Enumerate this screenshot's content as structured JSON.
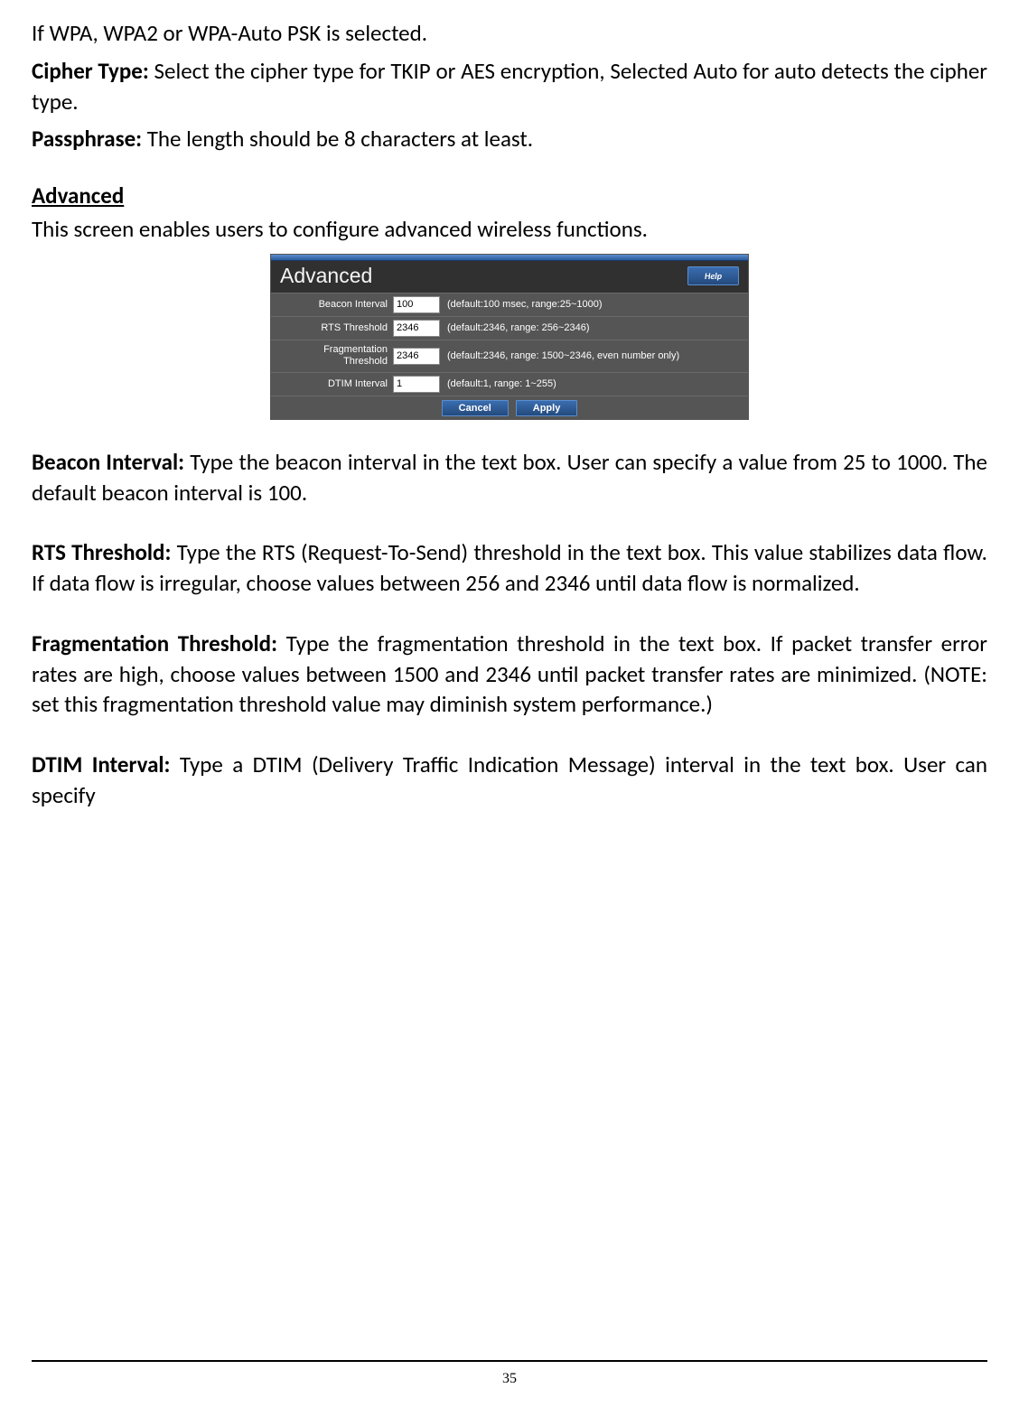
{
  "top": {
    "condition_line": "If WPA, WPA2 or WPA-Auto PSK is selected.",
    "cipher": {
      "label": "Cipher Type:",
      "text": " Select the cipher type for TKIP or AES encryption, Selected Auto for auto detects the cipher type."
    },
    "passphrase": {
      "label": "Passphrase:",
      "text": " The length should be 8 characters at least."
    }
  },
  "advanced": {
    "heading": "Advanced",
    "intro": "This screen enables users to configure advanced wireless functions."
  },
  "panel": {
    "title": "Advanced",
    "help_label": "Help",
    "rows": {
      "beacon": {
        "label": "Beacon Interval",
        "value": "100",
        "hint": "(default:100 msec, range:25~1000)"
      },
      "rts": {
        "label": "RTS Threshold",
        "value": "2346",
        "hint": "(default:2346, range: 256~2346)"
      },
      "frag": {
        "label_line1": "Fragmentation",
        "label_line2": "Threshold",
        "value": "2346",
        "hint": "(default:2346, range: 1500~2346, even number only)"
      },
      "dtim": {
        "label": "DTIM Interval",
        "value": "1",
        "hint": "(default:1, range: 1~255)"
      }
    },
    "buttons": {
      "cancel": "Cancel",
      "apply": "Apply"
    }
  },
  "descriptions": {
    "beacon": {
      "label": "Beacon Interval:",
      "text": " Type the beacon interval in the text box. User can specify a value from 25 to 1000. The default beacon interval is 100."
    },
    "rts": {
      "label": "RTS Threshold:",
      "text": " Type the RTS (Request-To-Send) threshold in the text box. This value stabilizes data flow. If data flow is irregular, choose values between 256 and 2346 until data flow is normalized."
    },
    "frag": {
      "label": "Fragmentation Threshold:",
      "text": " Type the fragmentation threshold in the text box. If packet transfer error rates are high, choose values between 1500 and 2346 until packet transfer rates are minimized. (NOTE: set this fragmentation threshold value may diminish system performance.)"
    },
    "dtim": {
      "label": "DTIM Interval:",
      "text": " Type a DTIM (Delivery Traffic Indication Message) interval in the text box. User can specify"
    }
  },
  "page_number": "35"
}
